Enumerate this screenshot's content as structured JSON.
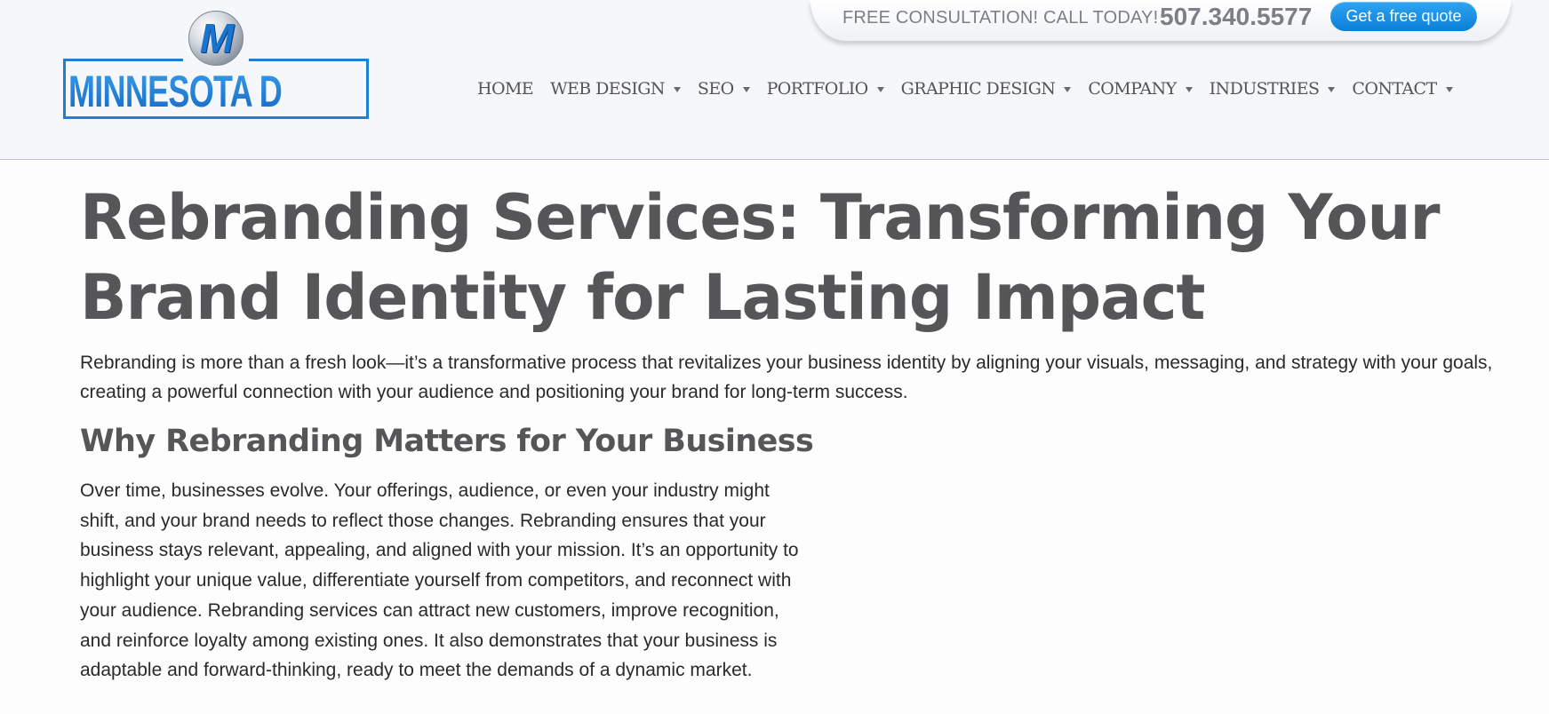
{
  "header": {
    "logo": {
      "badge_letter": "M",
      "text": "MINNESOTA DESIGN"
    },
    "consultation": {
      "text": "FREE CONSULTATION! CALL TODAY!",
      "phone": "507.340.5577",
      "quote_button": "Get a free quote"
    },
    "nav": [
      {
        "label": "HOME",
        "has_dropdown": false
      },
      {
        "label": "WEB DESIGN",
        "has_dropdown": true
      },
      {
        "label": "SEO",
        "has_dropdown": true
      },
      {
        "label": "PORTFOLIO",
        "has_dropdown": true
      },
      {
        "label": "GRAPHIC DESIGN",
        "has_dropdown": true
      },
      {
        "label": "COMPANY",
        "has_dropdown": true
      },
      {
        "label": "INDUSTRIES",
        "has_dropdown": true
      },
      {
        "label": "CONTACT",
        "has_dropdown": true
      }
    ]
  },
  "main": {
    "title_line1": "Rebranding Services: Transforming Your",
    "title_line2": "Brand Identity for Lasting Impact",
    "intro": "Rebranding is more than a fresh look—it’s a transformative process that revitalizes your business identity by aligning your visuals, messaging, and strategy with your goals, creating a powerful connection with your audience and positioning your brand for long-term success.",
    "section_heading": "Why Rebranding Matters for Your Business",
    "section_body": "Over time, businesses evolve. Your offerings, audience, or even your industry might shift, and your brand needs to reflect those changes. Rebranding ensures that your business stays relevant, appealing, and aligned with your mission. It’s an opportunity to highlight your unique value, differentiate yourself from competitors, and reconnect with your audience. Rebranding services can attract new customers, improve recognition, and reinforce loyalty among existing ones. It also demonstrates that your business is adaptable and forward-thinking, ready to meet the demands of a dynamic market."
  },
  "colors": {
    "brand_blue": "#1c7ad4",
    "button_blue": "#0a7fd6",
    "heading_gray": "#565659",
    "header_bg": "#f5f7fb"
  }
}
